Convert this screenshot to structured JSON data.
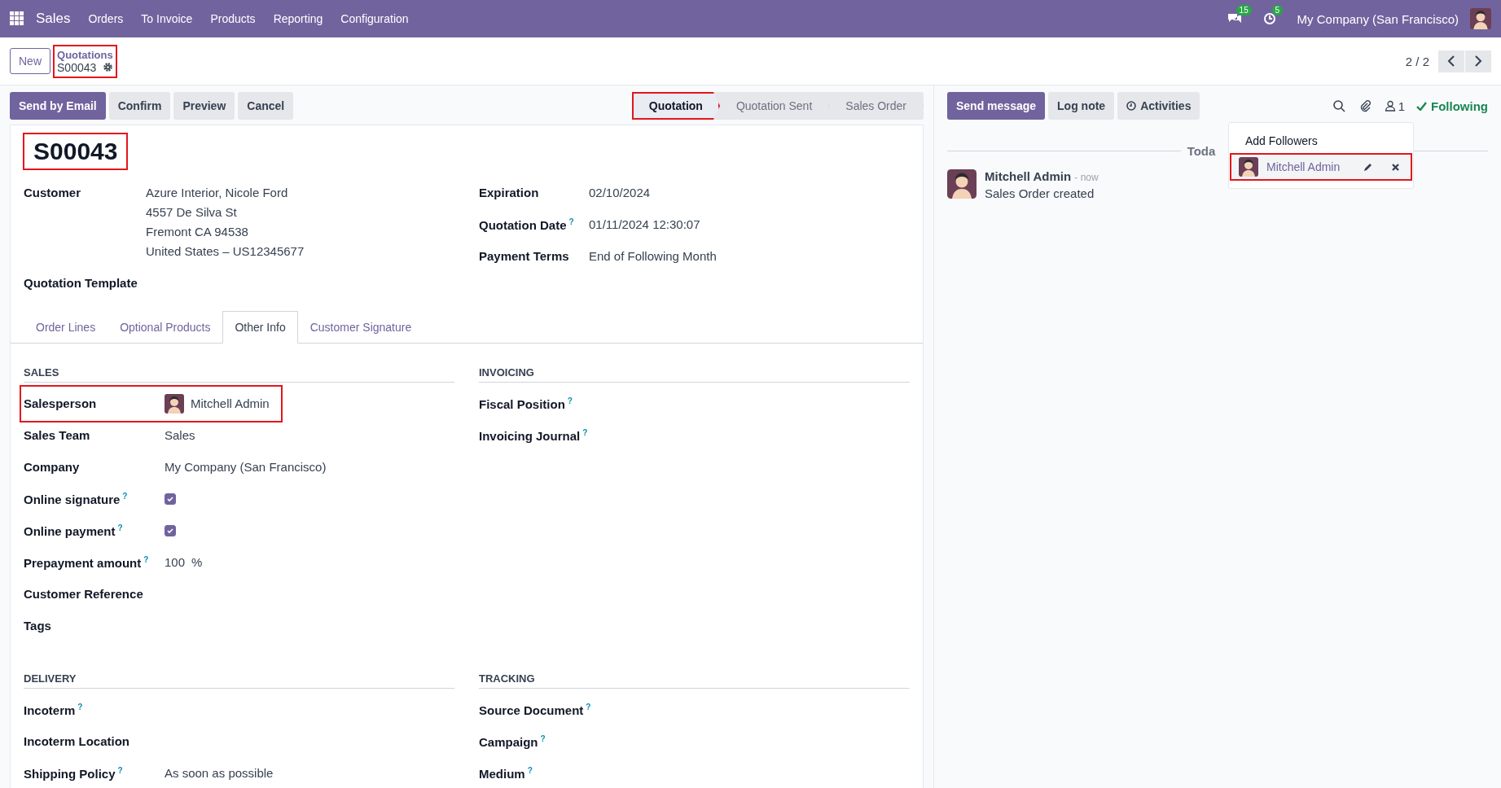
{
  "navbar": {
    "app": "Sales",
    "menu": [
      "Orders",
      "To Invoice",
      "Products",
      "Reporting",
      "Configuration"
    ],
    "messages_badge": "15",
    "activities_badge": "5",
    "company": "My Company (San Francisco)"
  },
  "control_panel": {
    "new_button": "New",
    "breadcrumb": {
      "parent": "Quotations",
      "current": "S00043",
      "highlighted": true
    },
    "pager": "2 / 2"
  },
  "actions": [
    {
      "label": "Send by Email",
      "kind": "primary"
    },
    {
      "label": "Confirm",
      "kind": "secondary"
    },
    {
      "label": "Preview",
      "kind": "secondary"
    },
    {
      "label": "Cancel",
      "kind": "secondary"
    }
  ],
  "statusbar": [
    {
      "label": "Quotation",
      "selected": true,
      "highlighted": true
    },
    {
      "label": "Quotation Sent",
      "selected": false,
      "highlighted": false
    },
    {
      "label": "Sales Order",
      "selected": false,
      "highlighted": false
    }
  ],
  "form": {
    "title": "S00043",
    "title_highlighted": true,
    "left_fields": [
      {
        "label": "Customer",
        "value_lines": [
          "Azure Interior, Nicole Ford",
          "4557 De Silva St",
          "Fremont CA 94538",
          "United States – US12345677"
        ]
      },
      {
        "label": "Quotation Template"
      }
    ],
    "right_fields": [
      {
        "label": "Expiration",
        "value": "02/10/2024"
      },
      {
        "label": "Quotation Date",
        "help": "?",
        "value": "01/11/2024 12:30:07"
      },
      {
        "label": "Payment Terms",
        "value": "End of Following Month"
      }
    ],
    "tabs": [
      {
        "label": "Order Lines",
        "selected": false
      },
      {
        "label": "Optional Products",
        "selected": false
      },
      {
        "label": "Other Info",
        "selected": true
      },
      {
        "label": "Customer Signature",
        "selected": false
      }
    ],
    "sections": [
      {
        "title": "SALES",
        "fields": [
          {
            "kind": "avatar",
            "label": "Salesperson",
            "value": "Mitchell Admin",
            "highlighted": true
          },
          {
            "kind": "text",
            "label": "Sales Team",
            "value": "Sales"
          },
          {
            "kind": "text",
            "label": "Company",
            "value": "My Company (San Francisco)"
          },
          {
            "kind": "checkbox",
            "label": "Online signature",
            "help": "?",
            "checked": true
          },
          {
            "kind": "checkbox",
            "label": "Online payment",
            "help": "?",
            "checked": true
          },
          {
            "kind": "percent",
            "label": "Prepayment amount",
            "help": "?",
            "value": "100",
            "unit": "%"
          },
          {
            "kind": "text",
            "label": "Customer Reference"
          },
          {
            "kind": "text",
            "label": "Tags"
          }
        ]
      },
      {
        "title": "INVOICING",
        "fields": [
          {
            "kind": "text",
            "label": "Fiscal Position",
            "help": "?"
          },
          {
            "kind": "text",
            "label": "Invoicing Journal",
            "help": "?"
          }
        ]
      },
      {
        "title": "DELIVERY",
        "fields": [
          {
            "kind": "text",
            "label": "Incoterm",
            "help": "?"
          },
          {
            "kind": "text",
            "label": "Incoterm Location"
          },
          {
            "kind": "text",
            "label": "Shipping Policy",
            "help": "?",
            "value": "As soon as possible"
          }
        ]
      },
      {
        "title": "TRACKING",
        "fields": [
          {
            "kind": "text",
            "label": "Source Document",
            "help": "?"
          },
          {
            "kind": "text",
            "label": "Campaign",
            "help": "?"
          },
          {
            "kind": "text",
            "label": "Medium",
            "help": "?"
          }
        ]
      }
    ]
  },
  "chatter": {
    "buttons": [
      {
        "label": "Send message",
        "kind": "primary"
      },
      {
        "label": "Log note",
        "kind": "secondary"
      },
      {
        "label": "Activities",
        "kind": "activities"
      }
    ],
    "followers_count": "1",
    "following": "Following",
    "date_separator": "Toda",
    "message": {
      "author": "Mitchell Admin",
      "time": "- now",
      "body": "Sales Order created"
    },
    "followers_menu": {
      "add": "Add Followers",
      "followers": [
        {
          "name": "Mitchell Admin",
          "highlighted": true
        }
      ]
    }
  }
}
